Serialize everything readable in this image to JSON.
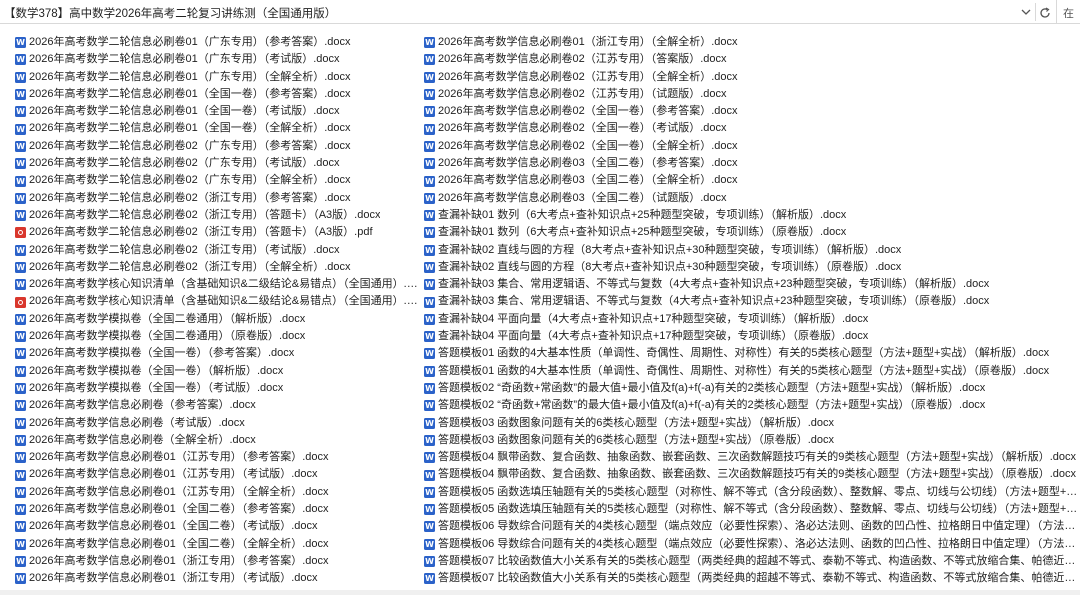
{
  "address_bar": {
    "path": "【数学378】高中数学2026年高考二轮复习讲练测（全国通用版）",
    "search_label": "在"
  },
  "left_column": [
    {
      "name": "2026年高考数学二轮信息必刷卷01（广东专用）（参考答案）.docx",
      "type": "docx"
    },
    {
      "name": "2026年高考数学二轮信息必刷卷01（广东专用）（考试版）.docx",
      "type": "docx"
    },
    {
      "name": "2026年高考数学二轮信息必刷卷01（广东专用）（全解全析）.docx",
      "type": "docx"
    },
    {
      "name": "2026年高考数学二轮信息必刷卷01（全国一卷）（参考答案）.docx",
      "type": "docx"
    },
    {
      "name": "2026年高考数学二轮信息必刷卷01（全国一卷）（考试版）.docx",
      "type": "docx"
    },
    {
      "name": "2026年高考数学二轮信息必刷卷01（全国一卷）（全解全析）.docx",
      "type": "docx"
    },
    {
      "name": "2026年高考数学二轮信息必刷卷02（广东专用）（参考答案）.docx",
      "type": "docx"
    },
    {
      "name": "2026年高考数学二轮信息必刷卷02（广东专用）（考试版）.docx",
      "type": "docx"
    },
    {
      "name": "2026年高考数学二轮信息必刷卷02（广东专用）（全解全析）.docx",
      "type": "docx"
    },
    {
      "name": "2026年高考数学二轮信息必刷卷02（浙江专用）（参考答案）.docx",
      "type": "docx"
    },
    {
      "name": "2026年高考数学二轮信息必刷卷02（浙江专用）（答题卡）（A3版）.docx",
      "type": "docx"
    },
    {
      "name": "2026年高考数学二轮信息必刷卷02（浙江专用）（答题卡）（A3版）.pdf",
      "type": "pdf"
    },
    {
      "name": "2026年高考数学二轮信息必刷卷02（浙江专用）（考试版）.docx",
      "type": "docx"
    },
    {
      "name": "2026年高考数学二轮信息必刷卷02（浙江专用）（全解全析）.docx",
      "type": "docx"
    },
    {
      "name": "2026年高考数学核心知识清单（含基础知识&二级结论&易错点）（全国通用）.docx",
      "type": "docx"
    },
    {
      "name": "2026年高考数学核心知识清单（含基础知识&二级结论&易错点）（全国通用）.pdf",
      "type": "pdf"
    },
    {
      "name": "2026年高考数学模拟卷（全国二卷通用）（解析版）.docx",
      "type": "docx"
    },
    {
      "name": "2026年高考数学模拟卷（全国二卷通用）（原卷版）.docx",
      "type": "docx"
    },
    {
      "name": "2026年高考数学模拟卷（全国一卷）（参考答案）.docx",
      "type": "docx"
    },
    {
      "name": "2026年高考数学模拟卷（全国一卷）（解析版）.docx",
      "type": "docx"
    },
    {
      "name": "2026年高考数学模拟卷（全国一卷）（考试版）.docx",
      "type": "docx"
    },
    {
      "name": "2026年高考数学信息必刷卷（参考答案）.docx",
      "type": "docx"
    },
    {
      "name": "2026年高考数学信息必刷卷（考试版）.docx",
      "type": "docx"
    },
    {
      "name": "2026年高考数学信息必刷卷（全解全析）.docx",
      "type": "docx"
    },
    {
      "name": "2026年高考数学信息必刷卷01（江苏专用）（参考答案）.docx",
      "type": "docx"
    },
    {
      "name": "2026年高考数学信息必刷卷01（江苏专用）（考试版）.docx",
      "type": "docx"
    },
    {
      "name": "2026年高考数学信息必刷卷01（江苏专用）（全解全析）.docx",
      "type": "docx"
    },
    {
      "name": "2026年高考数学信息必刷卷01（全国二卷）（参考答案）.docx",
      "type": "docx"
    },
    {
      "name": "2026年高考数学信息必刷卷01（全国二卷）（考试版）.docx",
      "type": "docx"
    },
    {
      "name": "2026年高考数学信息必刷卷01（全国二卷）（全解全析）.docx",
      "type": "docx"
    },
    {
      "name": "2026年高考数学信息必刷卷01（浙江专用）（参考答案）.docx",
      "type": "docx"
    },
    {
      "name": "2026年高考数学信息必刷卷01（浙江专用）（考试版）.docx",
      "type": "docx"
    }
  ],
  "right_column": [
    {
      "name": "2026年高考数学信息必刷卷01（浙江专用）（全解全析）.docx",
      "type": "docx"
    },
    {
      "name": "2026年高考数学信息必刷卷02（江苏专用）（答案版）.docx",
      "type": "docx"
    },
    {
      "name": "2026年高考数学信息必刷卷02（江苏专用）（全解全析）.docx",
      "type": "docx"
    },
    {
      "name": "2026年高考数学信息必刷卷02（江苏专用）（试题版）.docx",
      "type": "docx"
    },
    {
      "name": "2026年高考数学信息必刷卷02（全国一卷）（参考答案）.docx",
      "type": "docx"
    },
    {
      "name": "2026年高考数学信息必刷卷02（全国一卷）（考试版）.docx",
      "type": "docx"
    },
    {
      "name": "2026年高考数学信息必刷卷02（全国一卷）（全解全析）.docx",
      "type": "docx"
    },
    {
      "name": "2026年高考数学信息必刷卷03（全国二卷）（参考答案）.docx",
      "type": "docx"
    },
    {
      "name": "2026年高考数学信息必刷卷03（全国二卷）（全解全析）.docx",
      "type": "docx"
    },
    {
      "name": "2026年高考数学信息必刷卷03（全国二卷）（试题版）.docx",
      "type": "docx"
    },
    {
      "name": "查漏补缺01 数列（6大考点+查补知识点+25种题型突破，专项训练）（解析版）.docx",
      "type": "docx"
    },
    {
      "name": "查漏补缺01 数列（6大考点+查补知识点+25种题型突破，专项训练）（原卷版）.docx",
      "type": "docx"
    },
    {
      "name": "查漏补缺02 直线与圆的方程（8大考点+查补知识点+30种题型突破，专项训练）（解析版）.docx",
      "type": "docx"
    },
    {
      "name": "查漏补缺02 直线与圆的方程（8大考点+查补知识点+30种题型突破，专项训练）（原卷版）.docx",
      "type": "docx"
    },
    {
      "name": "查漏补缺03 集合、常用逻辑语、不等式与复数（4大考点+查补知识点+23种题型突破，专项训练）（解析版）.docx",
      "type": "docx"
    },
    {
      "name": "查漏补缺03 集合、常用逻辑语、不等式与复数（4大考点+查补知识点+23种题型突破，专项训练）（原卷版）.docx",
      "type": "docx"
    },
    {
      "name": "查漏补缺04 平面向量（4大考点+查补知识点+17种题型突破，专项训练）（解析版）.docx",
      "type": "docx"
    },
    {
      "name": "查漏补缺04 平面向量（4大考点+查补知识点+17种题型突破，专项训练）（原卷版）.docx",
      "type": "docx"
    },
    {
      "name": "答题模板01 函数的4大基本性质（单调性、奇偶性、周期性、对称性）有关的5类核心题型（方法+题型+实战）（解析版）.docx",
      "type": "docx"
    },
    {
      "name": "答题模板01 函数的4大基本性质（单调性、奇偶性、周期性、对称性）有关的5类核心题型（方法+题型+实战）（原卷版）.docx",
      "type": "docx"
    },
    {
      "name": "答题模板02 “奇函数+常函数”的最大值+最小值及f(a)+f(-a)有关的2类核心题型（方法+题型+实战）（解析版）.docx",
      "type": "docx"
    },
    {
      "name": "答题模板02 “奇函数+常函数”的最大值+最小值及f(a)+f(-a)有关的2类核心题型（方法+题型+实战）（原卷版）.docx",
      "type": "docx"
    },
    {
      "name": "答题模板03 函数图象问题有关的6类核心题型（方法+题型+实战）（解析版）.docx",
      "type": "docx"
    },
    {
      "name": "答题模板03 函数图象问题有关的6类核心题型（方法+题型+实战）（原卷版）.docx",
      "type": "docx"
    },
    {
      "name": "答题模板04 飘带函数、复合函数、抽象函数、嵌套函数、三次函数解题技巧有关的9类核心题型（方法+题型+实战）（解析版）.docx",
      "type": "docx"
    },
    {
      "name": "答题模板04 飘带函数、复合函数、抽象函数、嵌套函数、三次函数解题技巧有关的9类核心题型（方法+题型+实战）（原卷版）.docx",
      "type": "docx"
    },
    {
      "name": "答题模板05 函数选填压轴题有关的5类核心题型（对称性、解不等式（含分段函数）、整数解、零点、切线与公切线）（方法+题型+实战）（解...",
      "type": "docx"
    },
    {
      "name": "答题模板05 函数选填压轴题有关的5类核心题型（对称性、解不等式（含分段函数）、整数解、零点、切线与公切线）（方法+题型+实战）（原...",
      "type": "docx"
    },
    {
      "name": "答题模板06 导数综合问题有关的4类核心题型（端点效应（必要性探索）、洛必达法则、函数的凹凸性、拉格朗日中值定理）（方法+题型+实战...",
      "type": "docx"
    },
    {
      "name": "答题模板06 导数综合问题有关的4类核心题型（端点效应（必要性探索）、洛必达法则、函数的凹凸性、拉格朗日中值定理）（方法+题型+实战...",
      "type": "docx"
    },
    {
      "name": "答题模板07 比较函数值大小关系有关的5类核心题型（两类经典的超越不等式、泰勒不等式、构造函数、不等式放缩合集、帕德近似）（方法+...",
      "type": "docx"
    },
    {
      "name": "答题模板07 比较函数值大小关系有关的5类核心题型（两类经典的超越不等式、泰勒不等式、构造函数、不等式放缩合集、帕德近似）（方法+...",
      "type": "docx"
    }
  ]
}
